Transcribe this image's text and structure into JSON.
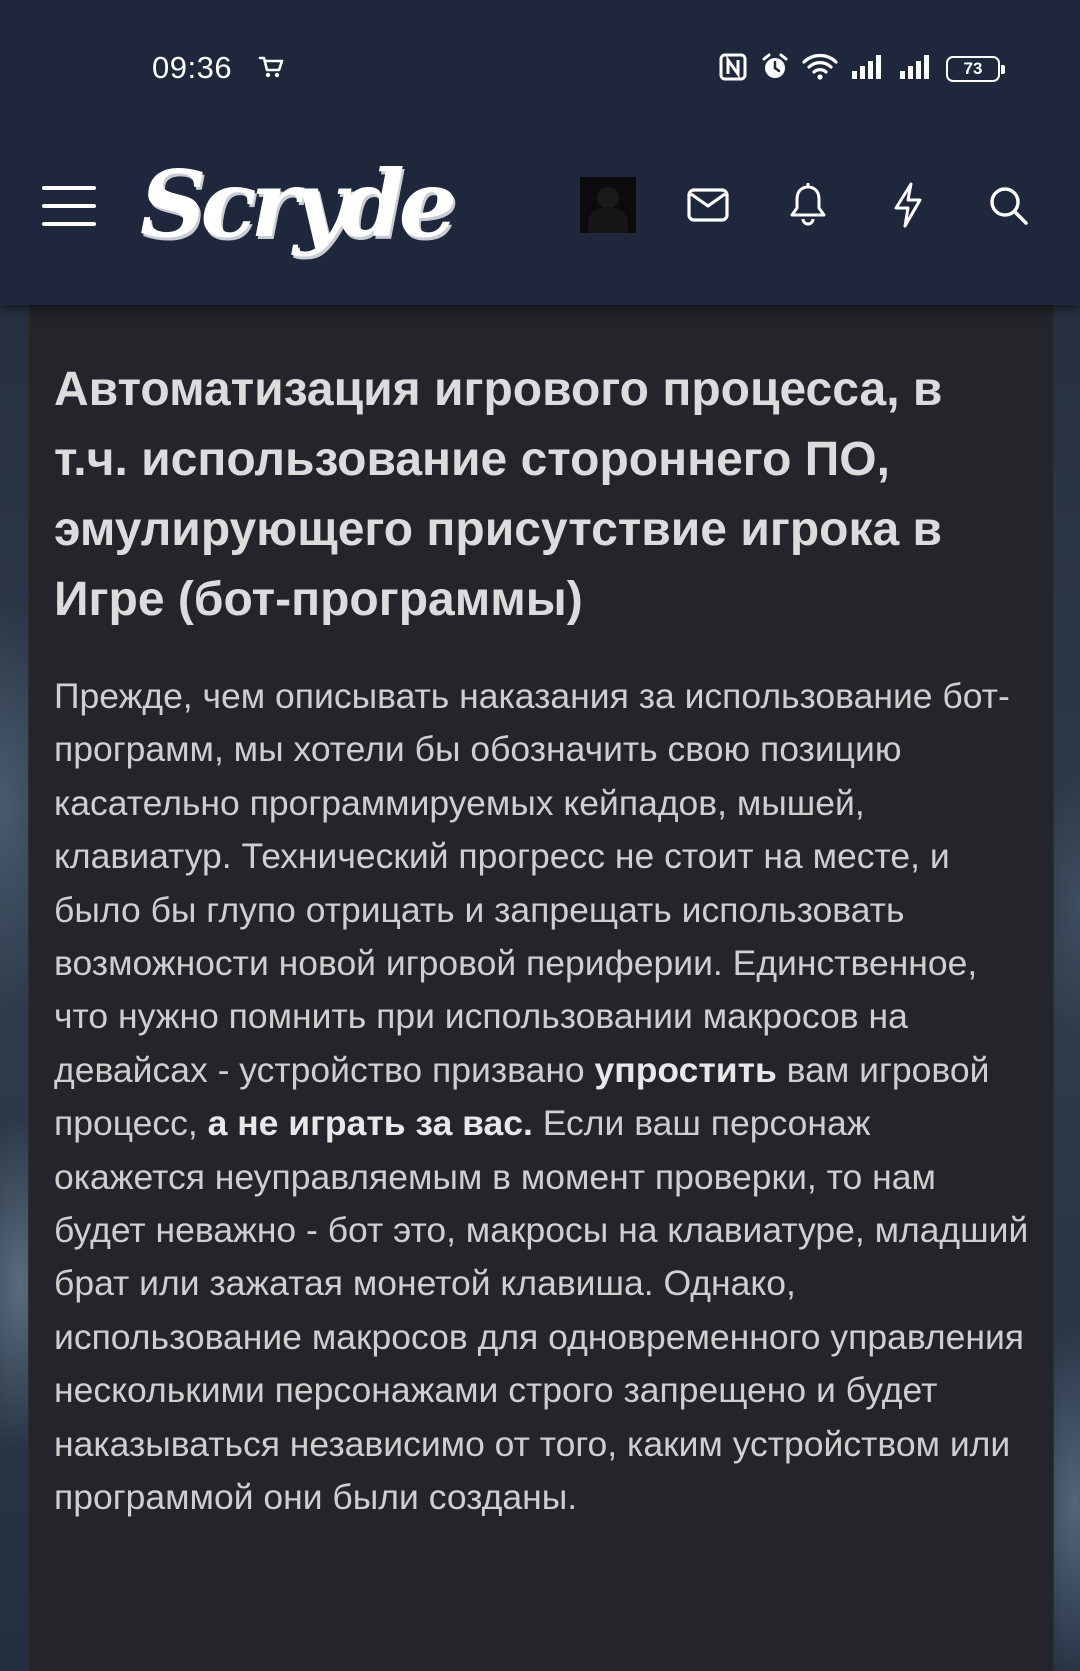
{
  "status_bar": {
    "time": "09:36",
    "battery": "73",
    "icons": [
      "cart-icon",
      "nfc-icon",
      "alarm-icon",
      "wifi-icon",
      "signal-icon",
      "signal-icon"
    ]
  },
  "header": {
    "logo": "Scryde",
    "icons": [
      "menu-icon",
      "avatar",
      "mail-icon",
      "bell-icon",
      "lightning-icon",
      "search-icon"
    ]
  },
  "article": {
    "title": "Автоматизация игрового процесса, в т.ч. использование стороннего ПО, эмулирующего присутствие игрока в Игре (бот-программы)",
    "body_part1": "Прежде, чем описывать наказания за использование бот-программ, мы хотели бы обозначить свою позицию касательно программируемых кейпадов, мышей, клавиатур. Технический прогресс не стоит на месте, и было бы глупо отрицать и запрещать использовать возможности новой игровой периферии. Единственное, что нужно помнить при использовании макросов на девайсах - устройство призвано ",
    "body_bold1": "упростить",
    "body_part2": " вам игровой процесс, ",
    "body_bold2": "а не играть за вас.",
    "body_part3": " Если ваш персонаж окажется неуправляемым в момент проверки, то нам будет неважно - бот это, макросы на клавиатуре, младший брат или зажатая монетой клавиша. Однако, использование макросов для одновременного управления несколькими персонажами строго запрещено и будет наказываться независимо от того, каким устройством или программой они были созданы."
  },
  "colors": {
    "header_bg": "#1e273b",
    "card_bg": "#23252b",
    "text": "#cfcfcf"
  }
}
